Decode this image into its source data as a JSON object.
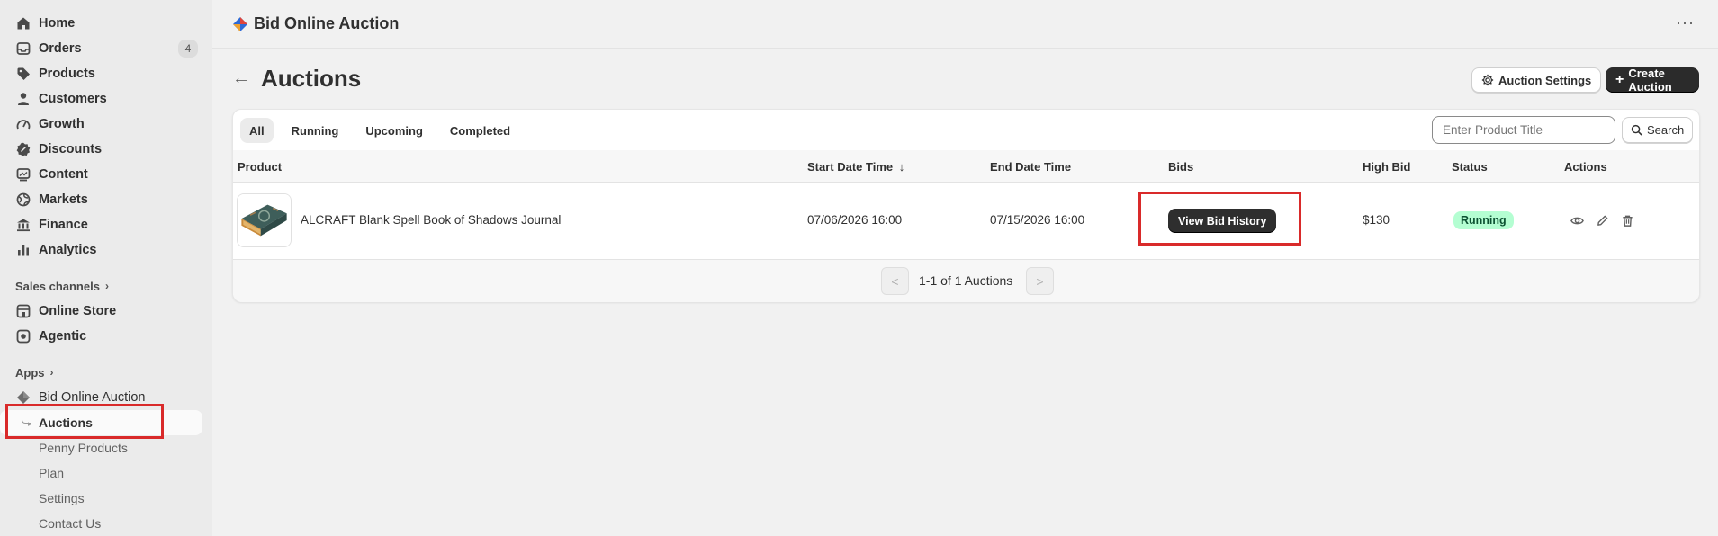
{
  "sidebar": {
    "nav": [
      {
        "label": "Home",
        "icon": "home-icon"
      },
      {
        "label": "Orders",
        "icon": "inbox-icon",
        "badge": "4"
      },
      {
        "label": "Products",
        "icon": "tag-icon"
      },
      {
        "label": "Customers",
        "icon": "person-icon"
      },
      {
        "label": "Growth",
        "icon": "gauge-icon"
      },
      {
        "label": "Discounts",
        "icon": "discount-icon"
      },
      {
        "label": "Content",
        "icon": "content-icon"
      },
      {
        "label": "Markets",
        "icon": "globe-icon"
      },
      {
        "label": "Finance",
        "icon": "bank-icon"
      },
      {
        "label": "Analytics",
        "icon": "bar-chart-icon"
      }
    ],
    "sales_channels_label": "Sales channels",
    "channels": [
      {
        "label": "Online Store",
        "icon": "store-icon"
      },
      {
        "label": "Agentic",
        "icon": "agentic-icon"
      }
    ],
    "apps_label": "Apps",
    "app_name": "Bid Online Auction",
    "app_items": [
      "Auctions",
      "Penny Products",
      "Plan",
      "Settings",
      "Contact Us"
    ]
  },
  "header": {
    "app_title": "Bid Online Auction",
    "more": "···"
  },
  "page": {
    "title": "Auctions",
    "settings_button": "Auction Settings",
    "create_button": "Create Auction"
  },
  "tabs": [
    "All",
    "Running",
    "Upcoming",
    "Completed"
  ],
  "search": {
    "placeholder": "Enter Product Title",
    "button": "Search"
  },
  "table": {
    "columns": {
      "product": "Product",
      "start": "Start Date Time",
      "end": "End Date Time",
      "bids": "Bids",
      "high_bid": "High Bid",
      "status": "Status",
      "actions": "Actions"
    },
    "sort_indicator": "↓",
    "rows": [
      {
        "product": "ALCRAFT Blank Spell Book of Shadows Journal",
        "start": "07/06/2026 16:00",
        "end": "07/15/2026 16:00",
        "bids_button": "View Bid History",
        "high_bid": "$130",
        "status": "Running"
      }
    ]
  },
  "pagination": {
    "prev": "<",
    "next": ">",
    "summary": "1-1 of 1 Auctions"
  },
  "colors": {
    "accent_dark": "#2b2b2b",
    "status_running_bg": "#b4fed2",
    "highlight_red": "#d92a2a"
  }
}
